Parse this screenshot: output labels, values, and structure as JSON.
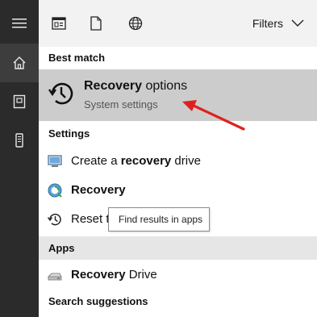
{
  "rail": {
    "items": [
      {
        "icon": "hamburger-menu-icon"
      },
      {
        "icon": "home-icon"
      },
      {
        "icon": "documents-icon"
      },
      {
        "icon": "device-icon"
      }
    ]
  },
  "toolbar": {
    "filters_label": "Filters",
    "icons": [
      "apps-filter-icon",
      "documents-filter-icon",
      "web-filter-icon"
    ]
  },
  "sections": {
    "best_match": "Best match",
    "settings": "Settings",
    "apps": "Apps",
    "search_suggestions": "Search suggestions"
  },
  "best_match": {
    "title_bold": "Recovery",
    "title_rest": " options",
    "subtitle": "System settings",
    "icon": "history-clock-icon"
  },
  "settings_results": [
    {
      "pre": "Create a ",
      "bold": "recovery",
      "post": " drive",
      "icon": "create-recovery-drive-icon"
    },
    {
      "pre": "",
      "bold": "Recovery",
      "post": "",
      "icon": "recovery-control-panel-icon"
    },
    {
      "pre": "Reset t",
      "bold": "",
      "post": "",
      "icon": "reset-history-icon"
    }
  ],
  "apps_results": [
    {
      "pre": "",
      "bold": "Recovery",
      "post": " Drive",
      "icon": "recovery-drive-app-icon"
    }
  ],
  "tooltip": "Find results in apps",
  "colors": {
    "rail_bg": "#2b2b2b",
    "highlight": "#cccccc",
    "annotation_arrow": "#e02020"
  }
}
